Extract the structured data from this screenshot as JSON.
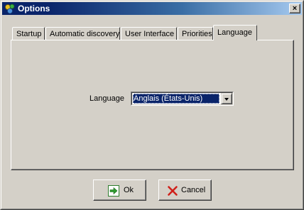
{
  "window": {
    "title": "Options",
    "close_glyph": "×"
  },
  "tabs": [
    {
      "label": "Startup",
      "active": false
    },
    {
      "label": "Automatic discovery",
      "active": false
    },
    {
      "label": "User Interface",
      "active": false
    },
    {
      "label": "Priorities",
      "active": false
    },
    {
      "label": "Language",
      "active": true
    }
  ],
  "language_panel": {
    "label": "Language",
    "selected_value": "Anglais (États-Unis)"
  },
  "buttons": {
    "ok_label": "Ok",
    "cancel_label": "Cancel"
  },
  "icons": {
    "app": "options-app-icon",
    "close": "close-icon",
    "dropdown": "chevron-down-icon",
    "ok": "green-arrow-right-icon",
    "cancel": "red-x-icon"
  },
  "colors": {
    "title_bar": "#0a246a",
    "selection": "#0a246a",
    "ok_icon": "#2e9c2e",
    "cancel_icon": "#d0201a"
  }
}
